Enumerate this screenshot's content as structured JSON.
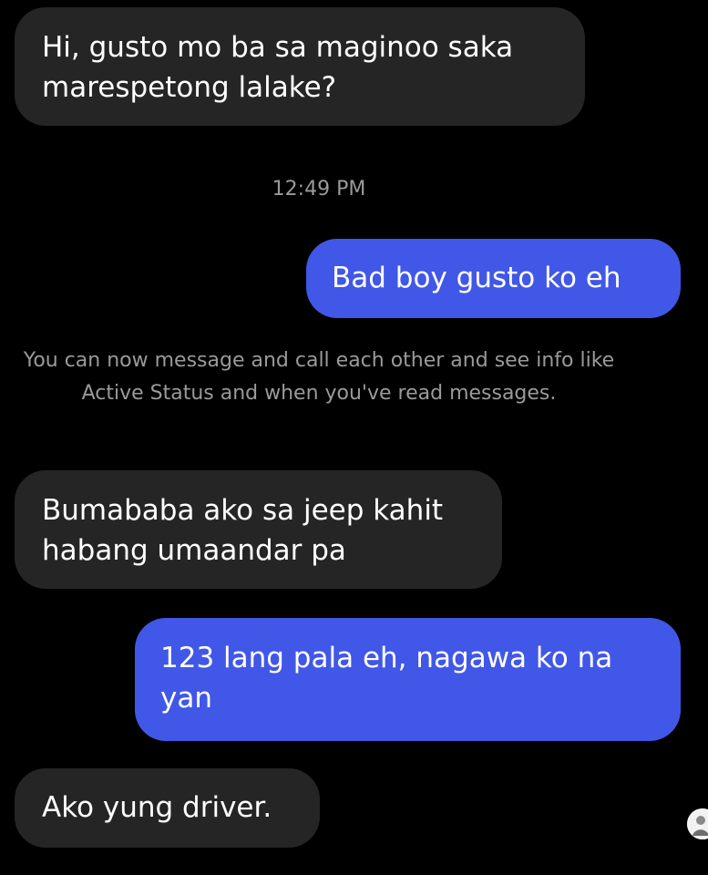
{
  "messages": [
    {
      "direction": "received",
      "text": "Hi, gusto mo ba sa maginoo saka marespetong lalake?"
    },
    {
      "direction": "sent",
      "text": "Bad boy gusto ko eh"
    },
    {
      "direction": "received",
      "text": "Bumababa ako sa jeep kahit habang umaandar pa"
    },
    {
      "direction": "sent",
      "text": "123 lang pala eh, nagawa ko na yan"
    },
    {
      "direction": "received",
      "text": "Ako yung driver."
    }
  ],
  "timestamp": "12:49 PM",
  "notice": "You can now message and call each other and see info like Active Status and when you've read messages.",
  "colors": {
    "background": "#000000",
    "received_bubble": "#252525",
    "sent_bubble": "#4157e8",
    "meta_text": "#9a9a9a"
  },
  "avatar_icon": "user-avatar-icon"
}
